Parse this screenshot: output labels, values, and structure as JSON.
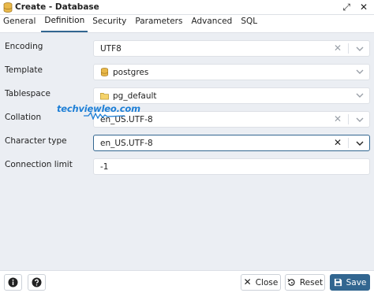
{
  "dialog": {
    "title": "Create - Database"
  },
  "tabs": [
    {
      "label": "General"
    },
    {
      "label": "Definition"
    },
    {
      "label": "Security"
    },
    {
      "label": "Parameters"
    },
    {
      "label": "Advanced"
    },
    {
      "label": "SQL"
    }
  ],
  "active_tab": "Definition",
  "fields": {
    "encoding": {
      "label": "Encoding",
      "value": "UTF8"
    },
    "template": {
      "label": "Template",
      "value": "postgres"
    },
    "tablespace": {
      "label": "Tablespace",
      "value": "pg_default"
    },
    "collation": {
      "label": "Collation",
      "value": "en_US.UTF-8"
    },
    "character_type": {
      "label": "Character type",
      "value": "en_US.UTF-8"
    },
    "connection_limit": {
      "label": "Connection limit",
      "value": "-1"
    }
  },
  "watermark": "techviewleo.com",
  "footer": {
    "close_label": "Close",
    "reset_label": "Reset",
    "save_label": "Save"
  },
  "colors": {
    "accent": "#326690",
    "watermark": "#1e7fd6"
  },
  "icons": {
    "title": "database-icon",
    "expand": "expand-icon",
    "close": "close-icon",
    "template": "database-icon",
    "tablespace": "folder-icon",
    "info": "info-icon",
    "help": "help-icon",
    "save": "floppy-disk-icon",
    "reset": "reset-icon",
    "close_btn": "x-icon"
  }
}
